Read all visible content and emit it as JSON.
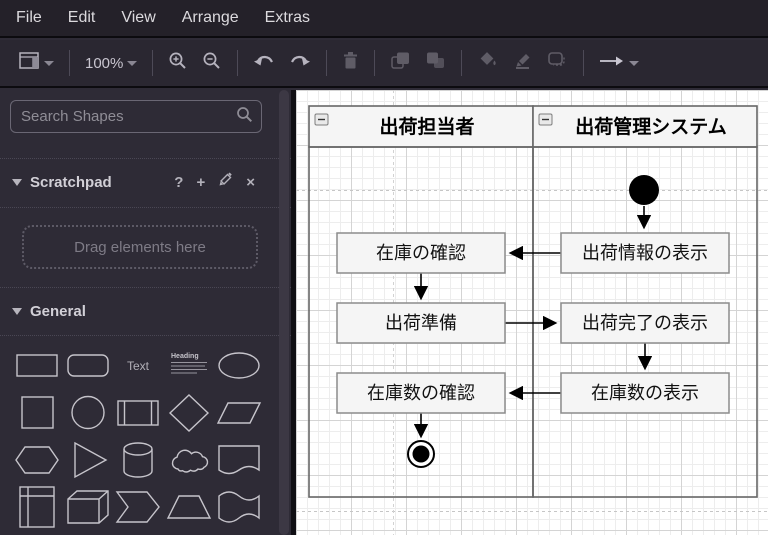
{
  "menu": {
    "items": [
      "File",
      "Edit",
      "View",
      "Arrange",
      "Extras"
    ]
  },
  "toolbar": {
    "zoom_level": "100%",
    "buttons": [
      "view-panels",
      "zoom-level",
      "zoom-in",
      "zoom-out",
      "undo",
      "redo",
      "delete",
      "to-front",
      "to-back",
      "fill-color",
      "line-color",
      "shadow",
      "connection-arrow"
    ]
  },
  "sidebar": {
    "search": {
      "placeholder": "Search Shapes"
    },
    "scratchpad": {
      "title": "Scratchpad",
      "help_glyph": "?",
      "add_glyph": "+",
      "close_glyph": "×",
      "dropzone_hint": "Drag elements here"
    },
    "general": {
      "title": "General"
    },
    "text_shape_label": "Text",
    "heading_shape_label": "Heading",
    "shape_names": [
      "rectangle",
      "rounded-rectangle",
      "text",
      "textbox",
      "ellipse",
      "square",
      "circle",
      "process",
      "diamond",
      "parallelogram",
      "hexagon",
      "triangle",
      "cylinder",
      "cloud",
      "document",
      "internal-storage",
      "cube",
      "step",
      "trapezoid",
      "tape"
    ]
  },
  "canvas": {
    "diagram_type": "uml-activity-swimlane",
    "lanes": [
      {
        "title": "出荷担当者"
      },
      {
        "title": "出荷管理システム"
      }
    ],
    "activities": [
      {
        "label": "在庫の確認"
      },
      {
        "label": "出荷情報の表示"
      },
      {
        "label": "出荷準備"
      },
      {
        "label": "出荷完了の表示"
      },
      {
        "label": "在庫数の確認"
      },
      {
        "label": "在庫数の表示"
      }
    ],
    "flows": [
      "start → 出荷情報の表示",
      "出荷情報の表示 → 在庫の確認",
      "在庫の確認 → 出荷準備",
      "出荷準備 → 出荷完了の表示",
      "出荷完了の表示 → 在庫数の表示",
      "在庫数の表示 → 在庫数の確認",
      "在庫数の確認 → end"
    ],
    "colors": {
      "node_fill": "#f5f5f5",
      "node_border": "#8c8c8c",
      "lane_border": "#676767",
      "arrow": "#000000"
    }
  }
}
